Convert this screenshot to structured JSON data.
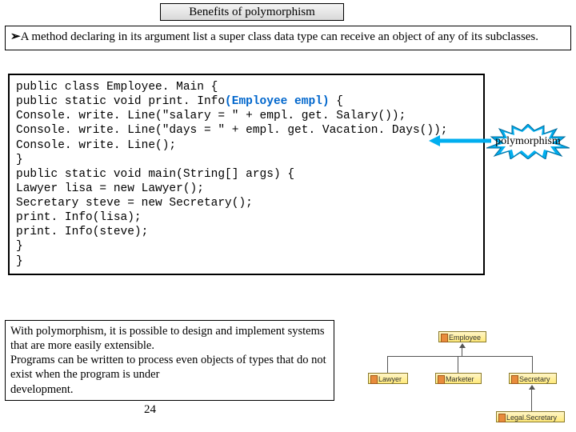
{
  "title": "Benefits of polymorphism",
  "bullet_marker": "➢",
  "intro": "A method declaring in its argument list a super class data type can receive an object of any of its subclasses.",
  "code": {
    "l1a": "public class Employee. Main {",
    "l2a": "public static void print. Info",
    "l2b": "(Employee empl)",
    "l2c": " {",
    "l3": "Console. write. Line(\"salary = \" + empl. get. Salary());",
    "l4": "Console. write. Line(\"days = \" + empl. get. Vacation. Days());",
    "l5": "Console. write. Line();",
    "l6": "}",
    "l7": "public static void main(String[] args) {",
    "l8": "Lawyer lisa = new Lawyer();",
    "l9": "Secretary steve = new Secretary();",
    "l10": "print. Info(lisa);",
    "l11": "print. Info(steve);",
    "l12": "}",
    "l13": "}"
  },
  "callout_label": "polymorphism",
  "summary": "With polymorphism, it is possible to design and implement systems that are more easily extensible.\nPrograms can be written to process even objects of types that do not exist when the program is under\ndevelopment.",
  "page_number": "24",
  "uml": {
    "employee": "Employee",
    "lawyer": "Lawyer",
    "marketer": "Marketer",
    "secretary": "Secretary",
    "legal_secretary": "Legal.Secretary"
  }
}
